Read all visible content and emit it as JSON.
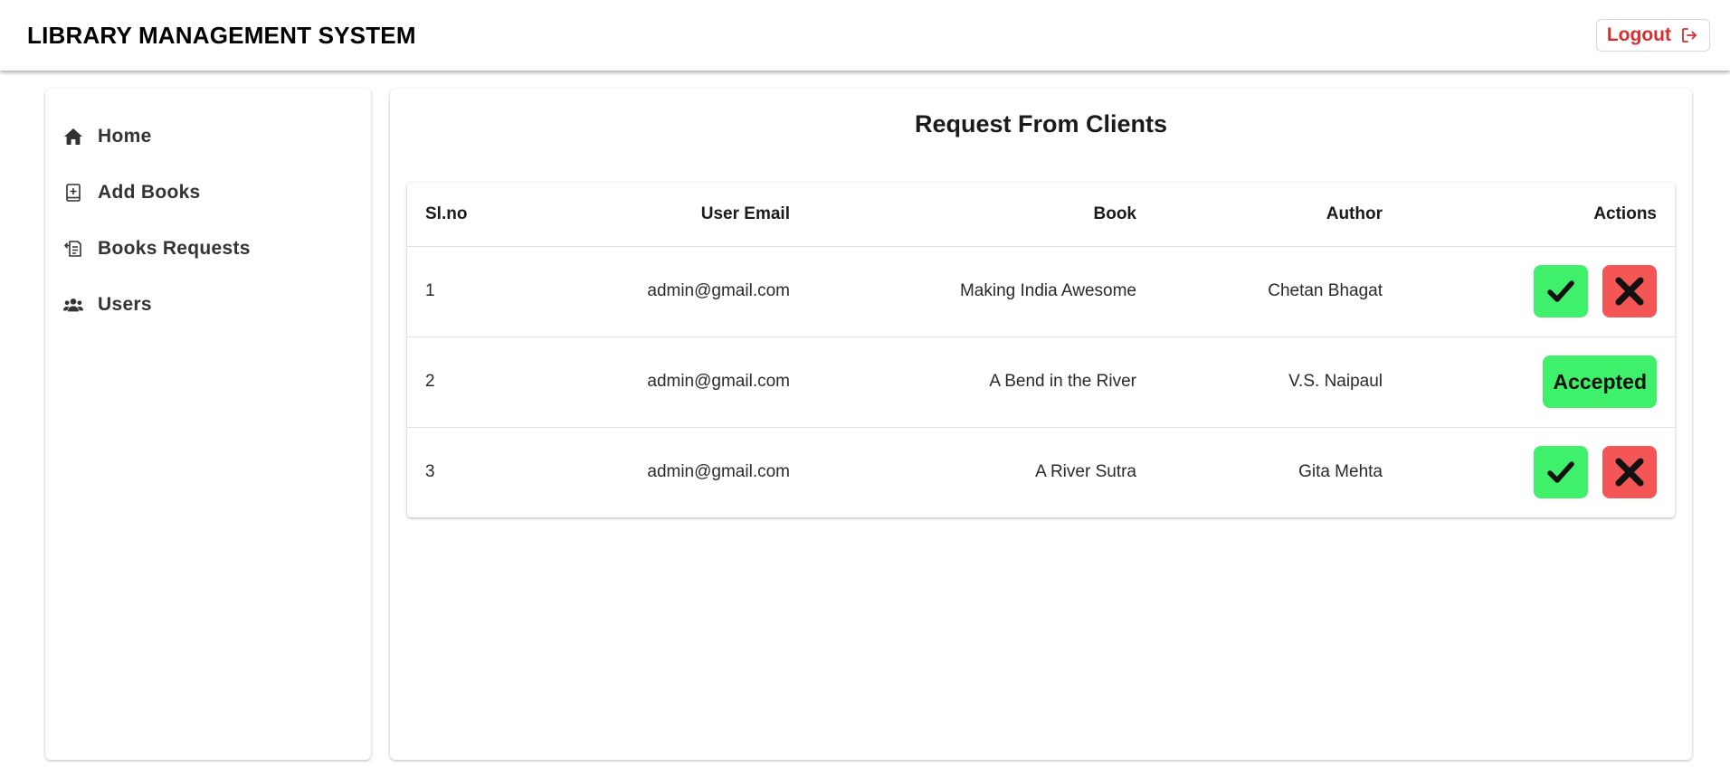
{
  "header": {
    "title": "LIBRARY MANAGEMENT SYSTEM",
    "logout_label": "Logout"
  },
  "sidebar": {
    "items": [
      {
        "label": "Home",
        "icon": "home-icon"
      },
      {
        "label": "Add Books",
        "icon": "add-book-icon"
      },
      {
        "label": "Books Requests",
        "icon": "book-request-icon"
      },
      {
        "label": "Users",
        "icon": "users-icon"
      }
    ]
  },
  "main": {
    "title": "Request From Clients",
    "table": {
      "headers": {
        "sl": "Sl.no",
        "email": "User Email",
        "book": "Book",
        "author": "Author",
        "actions": "Actions"
      },
      "rows": [
        {
          "sl": "1",
          "email": "admin@gmail.com",
          "book": "Making India Awesome",
          "author": "Chetan Bhagat",
          "status": "pending"
        },
        {
          "sl": "2",
          "email": "admin@gmail.com",
          "book": "A Bend in the River",
          "author": "V.S. Naipaul",
          "status": "Accepted"
        },
        {
          "sl": "3",
          "email": "admin@gmail.com",
          "book": "A River Sutra",
          "author": "Gita Mehta",
          "status": "pending"
        }
      ]
    }
  },
  "colors": {
    "accept_green": "#3ef06a",
    "reject_red": "#f45656",
    "logout_red": "#d32f2f"
  }
}
